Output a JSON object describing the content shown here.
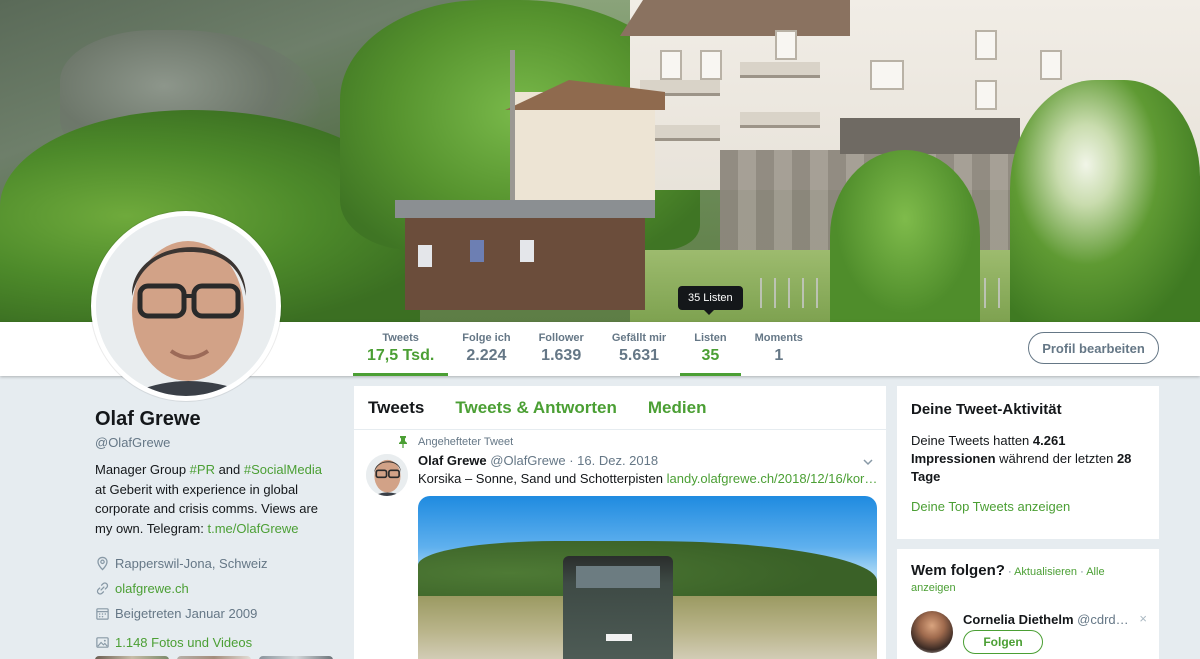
{
  "tooltip": {
    "lists": "35 Listen"
  },
  "stats": [
    {
      "label": "Tweets",
      "value": "17,5 Tsd."
    },
    {
      "label": "Folge ich",
      "value": "2.224"
    },
    {
      "label": "Follower",
      "value": "1.639"
    },
    {
      "label": "Gefällt mir",
      "value": "5.631"
    },
    {
      "label": "Listen",
      "value": "35"
    },
    {
      "label": "Moments",
      "value": "1"
    }
  ],
  "edit_profile": "Profil bearbeiten",
  "profile": {
    "name": "Olaf Grewe",
    "handle": "@OlafGrewe",
    "bio_1": "Manager Group ",
    "bio_tag1": "#PR",
    "bio_2": " and ",
    "bio_tag2": "#SocialMedia",
    "bio_3": " at Geberit with experience in global corporate and crisis comms. Views are my own. Telegram: ",
    "bio_link": "t.me/OlafGrewe",
    "location": "Rapperswil-Jona, Schweiz",
    "website": "olafgrewe.ch",
    "joined": "Beigetreten Januar 2009",
    "photos": "1.148 Fotos und Videos"
  },
  "timeline": {
    "tabs": [
      "Tweets",
      "Tweets & Antworten",
      "Medien"
    ],
    "pinned_label": "Angehefteter Tweet",
    "tweet": {
      "name": "Olaf Grewe",
      "handle": "@OlafGrewe",
      "sep": " · ",
      "date": "16. Dez. 2018",
      "text": "Korsika – Sonne, Sand und Schotterpisten ",
      "link": "landy.olafgrewe.ch/2018/12/16/kor…"
    }
  },
  "activity": {
    "title": "Deine Tweet-Aktivität",
    "text_1": "Deine Tweets hatten ",
    "impressions": "4.261",
    "text_2": "Impressionen",
    "text_3": " während der letzten ",
    "days": "28 Tage",
    "link": "Deine Top Tweets anzeigen"
  },
  "who_to_follow": {
    "title": "Wem folgen?",
    "sep": " · ",
    "refresh": "Aktualisieren",
    "sep2": " · ",
    "show_all": "Alle anzeigen",
    "suggestion": {
      "name": "Cornelia Diethelm",
      "handle": "@cdrd…",
      "follow": "Folgen",
      "close": "×"
    }
  },
  "colors": {
    "accent": "#4b9f34",
    "secondary_text": "#657786",
    "background": "#e6ecf0"
  }
}
